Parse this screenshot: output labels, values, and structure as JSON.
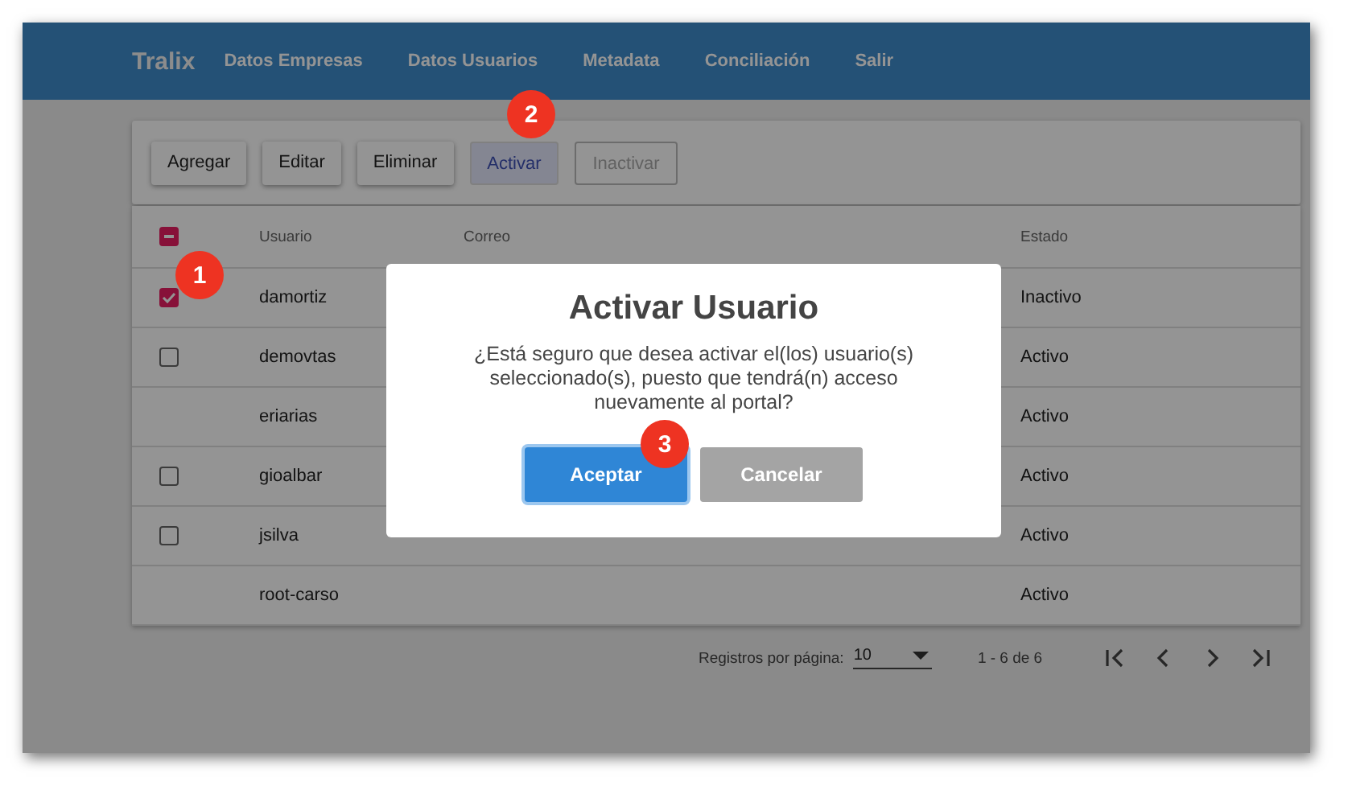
{
  "navbar": {
    "brand": "Tralix",
    "links": [
      "Datos Empresas",
      "Datos Usuarios",
      "Metadata",
      "Conciliación",
      "Salir"
    ]
  },
  "toolbar": [
    {
      "label": "Agregar",
      "selected": false,
      "disabled": false
    },
    {
      "label": "Editar",
      "selected": false,
      "disabled": false
    },
    {
      "label": "Eliminar",
      "selected": false,
      "disabled": false
    },
    {
      "label": "Activar",
      "selected": true,
      "disabled": false
    },
    {
      "label": "Inactivar",
      "selected": false,
      "disabled": true
    }
  ],
  "table": {
    "header_checkbox": {
      "indeterminate": true
    },
    "columns": [
      "Usuario",
      "Correo",
      "Estado"
    ],
    "rows": [
      {
        "kind": "checkbox",
        "checked": true,
        "usuario": "damortiz",
        "estado": "Inactivo"
      },
      {
        "kind": "checkbox",
        "checked": false,
        "usuario": "demovtas",
        "estado": "Activo"
      },
      {
        "kind": "plain",
        "usuario": "eriarias",
        "estado": "Activo"
      },
      {
        "kind": "checkbox",
        "checked": false,
        "usuario": "gioalbar",
        "estado": "Activo"
      },
      {
        "kind": "checkbox",
        "checked": false,
        "usuario": "jsilva",
        "estado": "Activo"
      },
      {
        "kind": "plain",
        "usuario": "root-carso",
        "estado": "Activo"
      }
    ]
  },
  "paginator": {
    "label": "Registros por página:",
    "page_size": "10",
    "range": "1 - 6 de 6"
  },
  "dialog": {
    "title": "Activar Usuario",
    "message": "¿Está seguro que desea activar el(los) usuario(s) seleccionado(s), puesto que tendrá(n) acceso nuevamente al portal?",
    "buttons": [
      {
        "label": "Aceptar",
        "kind": "primary"
      },
      {
        "label": "Cancelar",
        "kind": "secondary"
      }
    ]
  },
  "callouts": [
    "1",
    "2",
    "3"
  ]
}
